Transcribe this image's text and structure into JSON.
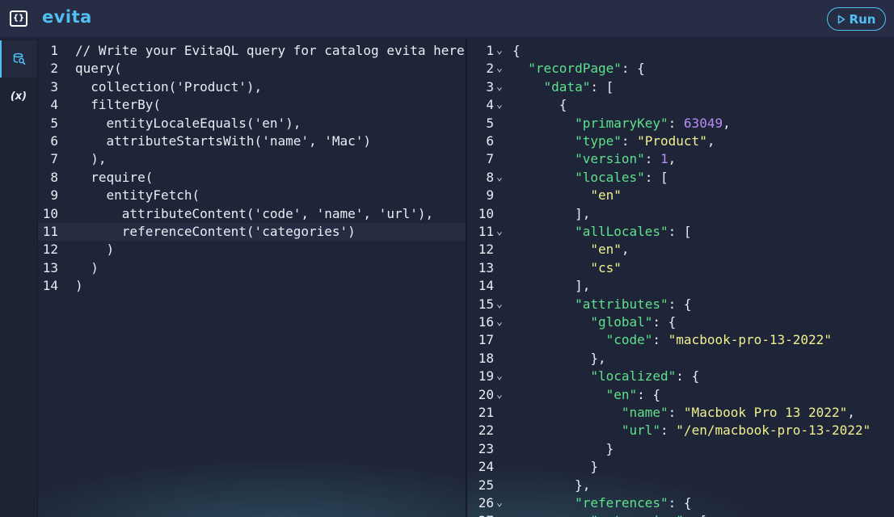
{
  "header": {
    "logo_text": "{}",
    "brand": "evita",
    "run_label": "Run",
    "accent": "#4fc0f0"
  },
  "sidebar": {
    "items": [
      {
        "icon": "query-search-icon",
        "active": true
      },
      {
        "icon": "variables-icon",
        "label": "(x)",
        "active": false
      }
    ]
  },
  "query_editor": {
    "highlighted_line": 11,
    "lines": [
      "// Write your EvitaQL query for catalog evita here",
      "query(",
      "  collection('Product'),",
      "  filterBy(",
      "    entityLocaleEquals('en'),",
      "    attributeStartsWith('name', 'Mac')",
      "  ),",
      "  require(",
      "    entityFetch(",
      "      attributeContent('code', 'name', 'url'),",
      "      referenceContent('categories')",
      "    )",
      "  )",
      ")"
    ]
  },
  "result_viewer": {
    "lines": [
      {
        "n": "1",
        "fold": true,
        "t": [
          [
            "p",
            "{"
          ]
        ]
      },
      {
        "n": "2",
        "fold": true,
        "t": [
          [
            "p",
            "  "
          ],
          [
            "k",
            "\"recordPage\""
          ],
          [
            "p",
            ": {"
          ]
        ]
      },
      {
        "n": "3",
        "fold": true,
        "t": [
          [
            "p",
            "    "
          ],
          [
            "k",
            "\"data\""
          ],
          [
            "p",
            ": ["
          ]
        ]
      },
      {
        "n": "4",
        "fold": true,
        "t": [
          [
            "p",
            "      {"
          ]
        ]
      },
      {
        "n": "5",
        "fold": false,
        "t": [
          [
            "p",
            "        "
          ],
          [
            "k",
            "\"primaryKey\""
          ],
          [
            "p",
            ": "
          ],
          [
            "n",
            "63049"
          ],
          [
            "p",
            ","
          ]
        ]
      },
      {
        "n": "6",
        "fold": false,
        "t": [
          [
            "p",
            "        "
          ],
          [
            "k",
            "\"type\""
          ],
          [
            "p",
            ": "
          ],
          [
            "s",
            "\"Product\""
          ],
          [
            "p",
            ","
          ]
        ]
      },
      {
        "n": "7",
        "fold": false,
        "t": [
          [
            "p",
            "        "
          ],
          [
            "k",
            "\"version\""
          ],
          [
            "p",
            ": "
          ],
          [
            "n",
            "1"
          ],
          [
            "p",
            ","
          ]
        ]
      },
      {
        "n": "8",
        "fold": true,
        "t": [
          [
            "p",
            "        "
          ],
          [
            "k",
            "\"locales\""
          ],
          [
            "p",
            ": ["
          ]
        ]
      },
      {
        "n": "9",
        "fold": false,
        "t": [
          [
            "p",
            "          "
          ],
          [
            "s",
            "\"en\""
          ]
        ]
      },
      {
        "n": "10",
        "fold": false,
        "t": [
          [
            "p",
            "        ],"
          ]
        ]
      },
      {
        "n": "11",
        "fold": true,
        "t": [
          [
            "p",
            "        "
          ],
          [
            "k",
            "\"allLocales\""
          ],
          [
            "p",
            ": ["
          ]
        ]
      },
      {
        "n": "12",
        "fold": false,
        "t": [
          [
            "p",
            "          "
          ],
          [
            "s",
            "\"en\""
          ],
          [
            "p",
            ","
          ]
        ]
      },
      {
        "n": "13",
        "fold": false,
        "t": [
          [
            "p",
            "          "
          ],
          [
            "s",
            "\"cs\""
          ]
        ]
      },
      {
        "n": "14",
        "fold": false,
        "t": [
          [
            "p",
            "        ],"
          ]
        ]
      },
      {
        "n": "15",
        "fold": true,
        "t": [
          [
            "p",
            "        "
          ],
          [
            "k",
            "\"attributes\""
          ],
          [
            "p",
            ": {"
          ]
        ]
      },
      {
        "n": "16",
        "fold": true,
        "t": [
          [
            "p",
            "          "
          ],
          [
            "k",
            "\"global\""
          ],
          [
            "p",
            ": {"
          ]
        ]
      },
      {
        "n": "17",
        "fold": false,
        "t": [
          [
            "p",
            "            "
          ],
          [
            "k",
            "\"code\""
          ],
          [
            "p",
            ": "
          ],
          [
            "s",
            "\"macbook-pro-13-2022\""
          ]
        ]
      },
      {
        "n": "18",
        "fold": false,
        "t": [
          [
            "p",
            "          },"
          ]
        ]
      },
      {
        "n": "19",
        "fold": true,
        "t": [
          [
            "p",
            "          "
          ],
          [
            "k",
            "\"localized\""
          ],
          [
            "p",
            ": {"
          ]
        ]
      },
      {
        "n": "20",
        "fold": true,
        "t": [
          [
            "p",
            "            "
          ],
          [
            "k",
            "\"en\""
          ],
          [
            "p",
            ": {"
          ]
        ]
      },
      {
        "n": "21",
        "fold": false,
        "t": [
          [
            "p",
            "              "
          ],
          [
            "k",
            "\"name\""
          ],
          [
            "p",
            ": "
          ],
          [
            "s",
            "\"Macbook Pro 13 2022\""
          ],
          [
            "p",
            ","
          ]
        ]
      },
      {
        "n": "22",
        "fold": false,
        "t": [
          [
            "p",
            "              "
          ],
          [
            "k",
            "\"url\""
          ],
          [
            "p",
            ": "
          ],
          [
            "s",
            "\"/en/macbook-pro-13-2022\""
          ]
        ]
      },
      {
        "n": "23",
        "fold": false,
        "t": [
          [
            "p",
            "            }"
          ]
        ]
      },
      {
        "n": "24",
        "fold": false,
        "t": [
          [
            "p",
            "          }"
          ]
        ]
      },
      {
        "n": "25",
        "fold": false,
        "t": [
          [
            "p",
            "        },"
          ]
        ]
      },
      {
        "n": "26",
        "fold": true,
        "t": [
          [
            "p",
            "        "
          ],
          [
            "k",
            "\"references\""
          ],
          [
            "p",
            ": {"
          ]
        ]
      },
      {
        "n": "27",
        "fold": false,
        "t": [
          [
            "p",
            "          "
          ],
          [
            "k",
            "\"categories\""
          ],
          [
            "p",
            ": ["
          ]
        ]
      }
    ]
  }
}
